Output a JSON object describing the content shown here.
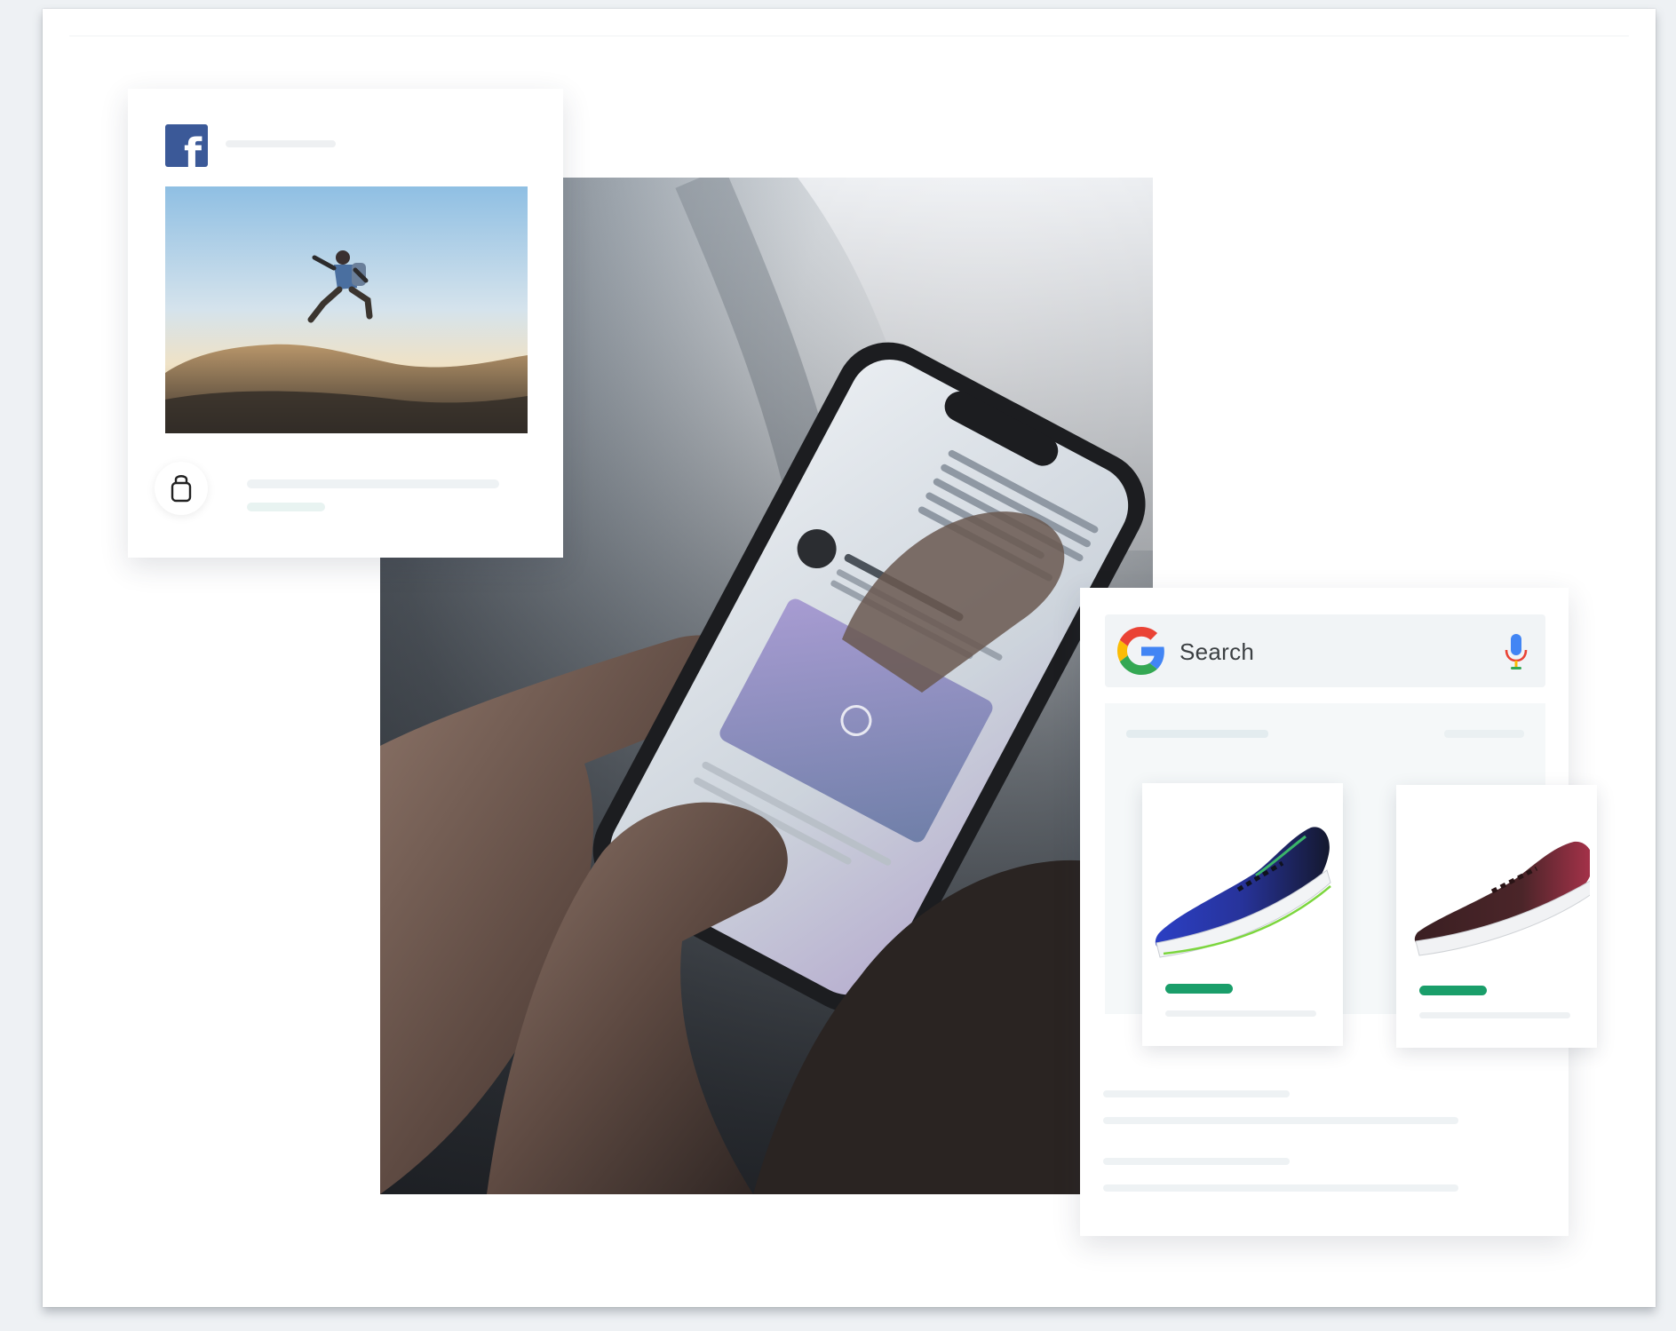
{
  "google_card": {
    "search_placeholder": "Search",
    "logo_icon": "google-g-icon",
    "mic_icon": "microphone-icon"
  },
  "facebook_card": {
    "logo_icon": "facebook-logo-icon",
    "shop_icon": "shopping-bag-icon"
  },
  "colors": {
    "facebook_blue": "#3b5998",
    "price_green": "#1a9e6a",
    "google_blue": "#4285F4",
    "google_red": "#EA4335",
    "google_yellow": "#FBBC05",
    "google_green": "#34A853"
  }
}
